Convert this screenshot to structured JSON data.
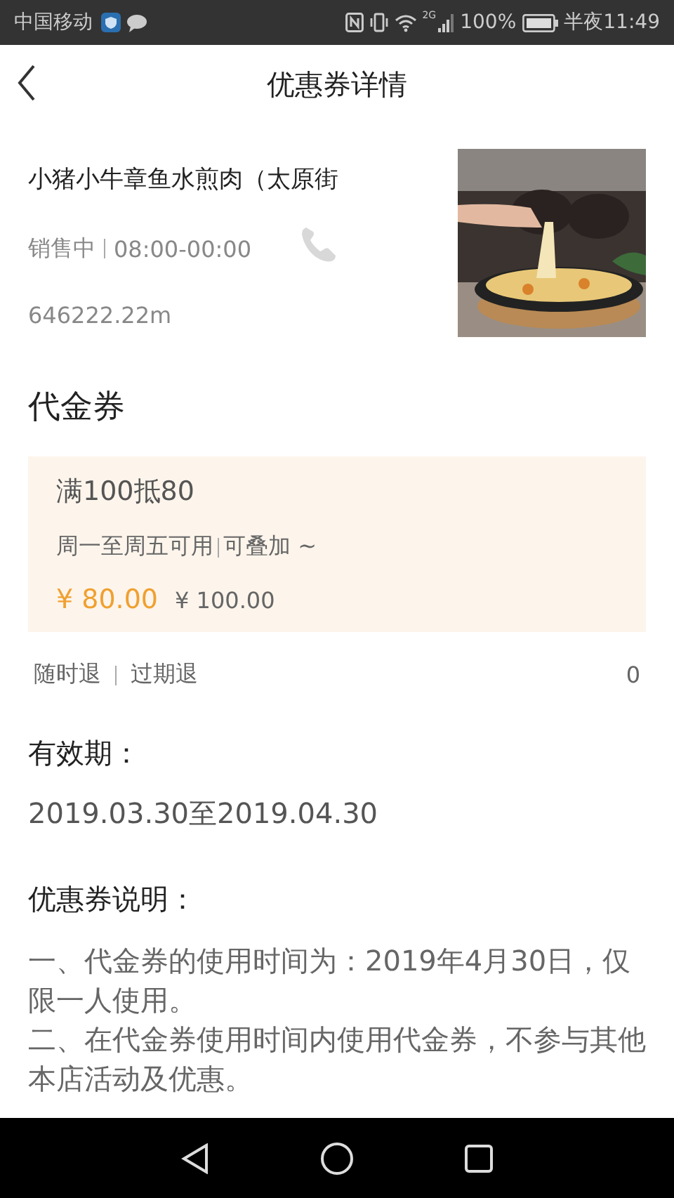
{
  "status_bar": {
    "carrier": "中国移动",
    "network": "2G",
    "battery": "100%",
    "time": "半夜11:49"
  },
  "header": {
    "title": "优惠券详情"
  },
  "shop": {
    "name": "小猪小牛章鱼水煎肉（太原街",
    "status": "销售中",
    "hours": "08:00-00:00",
    "distance": "646222.22m"
  },
  "section_title": "代金券",
  "coupon": {
    "title": "满100抵80",
    "usage": "周一至周五可用",
    "stack": "可叠加 ~",
    "price": "¥ 80.00",
    "original_price": "¥ 100.00"
  },
  "refund": {
    "anytime": "随时退",
    "expired": "过期退",
    "sold": "0"
  },
  "validity": {
    "label": "有效期：",
    "dates": "2019.03.30至2019.04.30"
  },
  "notes": {
    "label": "优惠券说明：",
    "items": [
      "一、代金券的使用时间为：2019年4月30日，仅限一人使用。",
      "二、在代金券使用时间内使用代金券，不参与其他本店活动及优惠。"
    ]
  }
}
